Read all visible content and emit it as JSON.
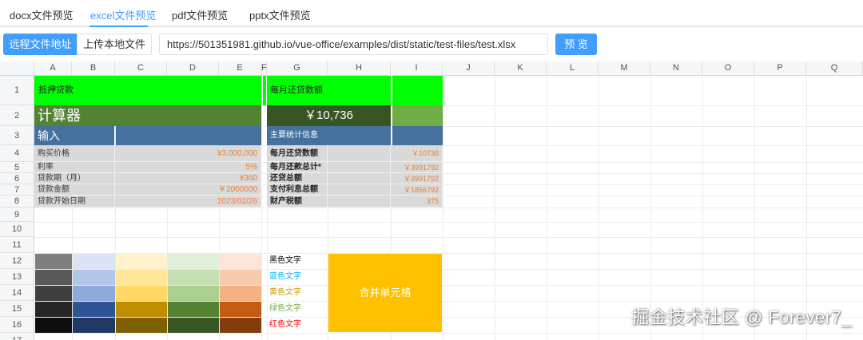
{
  "tabs": [
    "docx文件预览",
    "excel文件预览",
    "pdf文件预览",
    "pptx文件预览"
  ],
  "active_tab": 1,
  "toolbar": {
    "remote_button": "远程文件地址",
    "upload_button": "上传本地文件",
    "url_value": "https://501351981.github.io/vue-office/examples/dist/static/test-files/test.xlsx",
    "preview_button": "预 览"
  },
  "columns": [
    "A",
    "B",
    "C",
    "D",
    "E",
    "F",
    "G",
    "H",
    "I",
    "J",
    "K",
    "L",
    "M",
    "N",
    "O",
    "P",
    "Q"
  ],
  "rows": [
    "1",
    "2",
    "3",
    "4",
    "5",
    "6",
    "7",
    "8",
    "9",
    "10",
    "11",
    "12",
    "13",
    "14",
    "15",
    "16",
    "17"
  ],
  "sheet": {
    "mortgage_title": "抵押贷款",
    "monthly_title": "每月还贷数额",
    "calculator": "计算器",
    "monthly_amount": "￥10,736",
    "input_label": "输入",
    "stats_label": "主要统计信息",
    "inputs": [
      {
        "label": "购买价格",
        "value": "¥3,000,000"
      },
      {
        "label": "利率",
        "value": "5%"
      },
      {
        "label": "贷款期（月）",
        "value": "¥360"
      },
      {
        "label": "贷款金额",
        "value": "￥2000000"
      },
      {
        "label": "贷款开始日期",
        "value": "2023/02/26"
      }
    ],
    "stats": [
      {
        "label": "每月还贷数额",
        "value": "￥10736"
      },
      {
        "label": "每月还款总计*",
        "value": "￥3991792"
      },
      {
        "label": "还贷总额",
        "value": "￥3991792"
      },
      {
        "label": "支付利息总额",
        "value": "￥1856792"
      },
      {
        "label": "财产税额",
        "value": "375"
      }
    ],
    "color_texts": [
      {
        "text": "黑色文字",
        "color": "#000000"
      },
      {
        "text": "蓝色文字",
        "color": "#00b0f0"
      },
      {
        "text": "黄色文字",
        "color": "#c9a000"
      },
      {
        "text": "绿色文字",
        "color": "#70ad47"
      },
      {
        "text": "红色文字",
        "color": "#ff0000"
      }
    ],
    "merged_cell": "合并单元格",
    "palette": [
      [
        "#7f7f7f",
        "#dae3f3",
        "#fff2cc",
        "#e2efda",
        "#fce4d6"
      ],
      [
        "#595959",
        "#b4c6e7",
        "#ffe699",
        "#c6e0b4",
        "#f8cbad"
      ],
      [
        "#3f3f3f",
        "#8eaadb",
        "#ffd966",
        "#a9d08e",
        "#f4b183"
      ],
      [
        "#262626",
        "#2f5496",
        "#bf8f00",
        "#548235",
        "#c55a11"
      ],
      [
        "#0d0d0d",
        "#1f3864",
        "#7f6000",
        "#375623",
        "#843c0c"
      ]
    ]
  },
  "colors": {
    "accent": "#409eff",
    "green_bright": "#00ff00",
    "green_dark": "#548235",
    "green_darker": "#375623",
    "green_mid": "#70ad47",
    "blue_header": "#44719e",
    "merged_fill": "#ffc000"
  },
  "watermark": "掘金技术社区 @ Forever7_"
}
